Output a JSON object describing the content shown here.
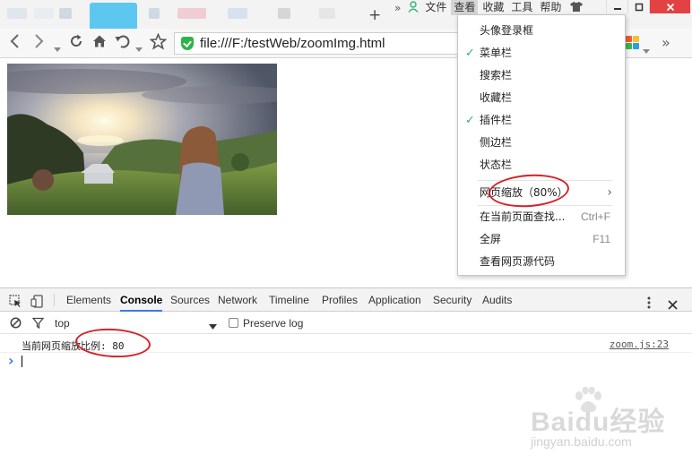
{
  "browser": {
    "new_tab": "+",
    "menubar_arrow": "»",
    "menus": [
      "文件",
      "查看",
      "收藏",
      "工具",
      "帮助"
    ],
    "active_menu": "查看",
    "address": "file:///F:/testWeb/zoomImg.html",
    "toolbar_more": "»"
  },
  "view_menu": {
    "items": [
      {
        "label": "头像登录框",
        "checked": false
      },
      {
        "label": "菜单栏",
        "checked": true
      },
      {
        "label": "搜索栏",
        "checked": false
      },
      {
        "label": "收藏栏",
        "checked": false
      },
      {
        "label": "插件栏",
        "checked": true
      },
      {
        "label": "侧边栏",
        "checked": false
      },
      {
        "label": "状态栏",
        "checked": false
      },
      {
        "label": "网页缩放（80%）",
        "submenu": true
      },
      {
        "label": "在当前页面查找...",
        "shortcut": "Ctrl+F"
      },
      {
        "label": "全屏",
        "shortcut": "F11"
      },
      {
        "label": "查看网页源代码"
      }
    ]
  },
  "devtools": {
    "tabs": [
      "Elements",
      "Console",
      "Sources",
      "Network",
      "Timeline",
      "Profiles",
      "Application",
      "Security",
      "Audits"
    ],
    "active_tab": "Console",
    "context": "top",
    "preserve_log": "Preserve log",
    "log_message": "当前网页缩放比例: 80",
    "log_source": "zoom.js:23",
    "prompt_symbol": "›"
  },
  "watermark": {
    "brand": "Baidu经验",
    "url": "jingyan.baidu.com"
  },
  "colors": {
    "accent_blue": "#3d7ae4",
    "check_green": "#2bb673",
    "annotation_red": "#d3232a",
    "close_red": "#e24242"
  }
}
